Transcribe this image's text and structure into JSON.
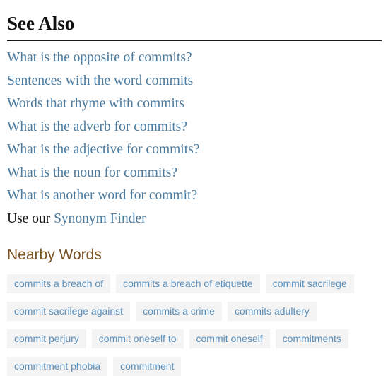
{
  "see_also": {
    "heading": "See Also",
    "links": [
      "What is the opposite of commits?",
      "Sentences with the word commits",
      "Words that rhyme with commits",
      "What is the adverb for commits?",
      "What is the adjective for commits?",
      "What is the noun for commits?",
      "What is another word for commit?"
    ],
    "use_our_prefix": "Use our ",
    "use_our_link": "Synonym Finder"
  },
  "nearby_words": {
    "heading": "Nearby Words",
    "tags": [
      "commits a breach of",
      "commits a breach of etiquette",
      "commit sacrilege",
      "commit sacrilege against",
      "commits a crime",
      "commits adultery",
      "commit perjury",
      "commit oneself to",
      "commit oneself",
      "commitments",
      "commitment phobia",
      "commitment"
    ]
  },
  "colors": {
    "link_blue": "#4a7a9e",
    "tag_blue": "#5a8fbb",
    "tag_background": "#f4f4f4",
    "nearby_heading_brown": "#7a5424",
    "heading_black": "#11100e",
    "rule": "#1b1b1b",
    "page_background": "#ffffff"
  }
}
